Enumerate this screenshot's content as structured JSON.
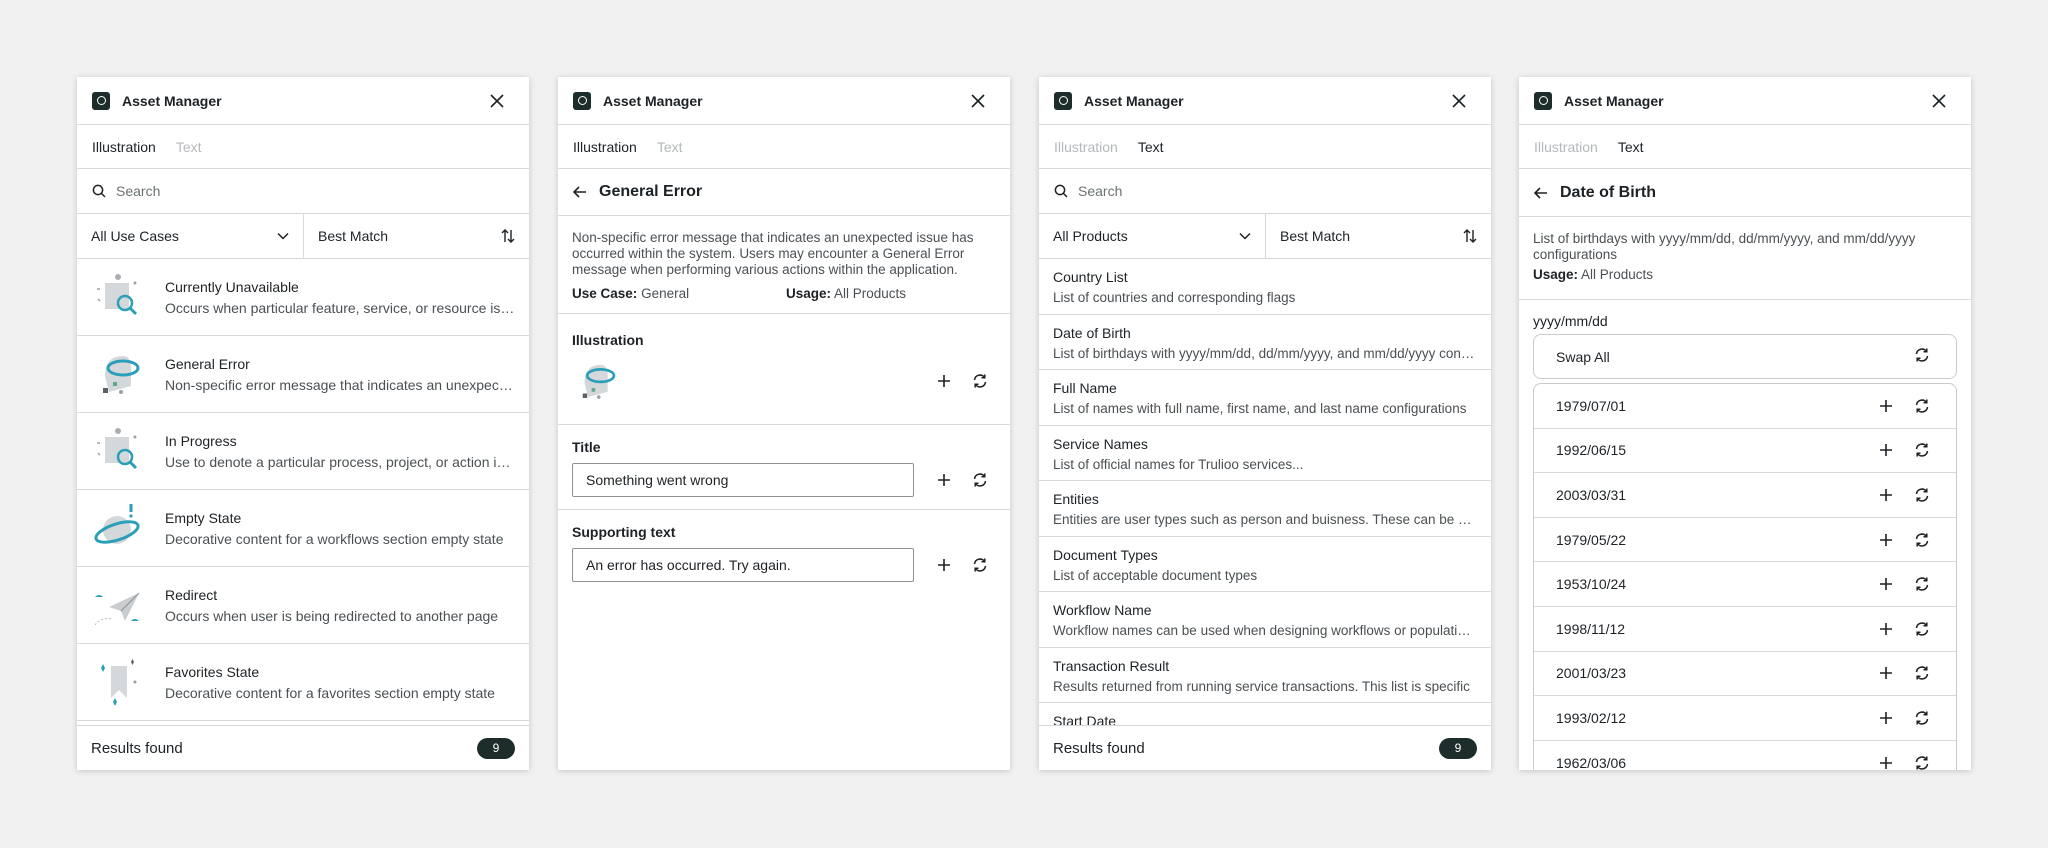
{
  "panels": {
    "p1": {
      "app_title": "Asset Manager",
      "tabs": [
        "Illustration",
        "Text"
      ],
      "active_tab": 0,
      "search_placeholder": "Search",
      "filter": "All Use Cases",
      "sort": "Best Match",
      "items": [
        {
          "title": "Currently Unavailable",
          "desc": "Occurs when particular feature, service, or resource is not available",
          "icon": "magnifier-illustration"
        },
        {
          "title": "General Error",
          "desc": "Non-specific error message that indicates an unexpected issue has occurred",
          "icon": "planet-error-illustration"
        },
        {
          "title": "In Progress",
          "desc": "Use to denote a particular process, project, or action is in progress",
          "icon": "magnifier-illustration"
        },
        {
          "title": "Empty State",
          "desc": "Decorative content for a workflows section empty state",
          "icon": "planet-illustration"
        },
        {
          "title": "Redirect",
          "desc": "Occurs when user is being redirected to another page",
          "icon": "paper-plane-illustration"
        },
        {
          "title": "Favorites State",
          "desc": "Decorative content for a favorites section empty state",
          "icon": "bookmark-illustration"
        }
      ],
      "results_label": "Results found",
      "results_count": "9"
    },
    "p2": {
      "app_title": "Asset Manager",
      "tabs": [
        "Illustration",
        "Text"
      ],
      "active_tab": 0,
      "back_title": "General Error",
      "description": "Non-specific error message that indicates an unexpected issue has occurred within the system. Users may encounter a General Error message when performing various actions within the application.",
      "use_case_label": "Use Case:",
      "use_case_value": "General",
      "usage_label": "Usage:",
      "usage_value": "All Products",
      "illustration_label": "Illustration",
      "title_label": "Title",
      "title_value": "Something went wrong",
      "supporting_label": "Supporting text",
      "supporting_value": "An error has occurred. Try again."
    },
    "p3": {
      "app_title": "Asset Manager",
      "tabs": [
        "Illustration",
        "Text"
      ],
      "active_tab": 1,
      "search_placeholder": "Search",
      "filter": "All Products",
      "sort": "Best Match",
      "items": [
        {
          "title": "Country List",
          "desc": "List of countries and corresponding flags"
        },
        {
          "title": "Date of Birth",
          "desc": "List of birthdays with yyyy/mm/dd, dd/mm/yyyy, and mm/dd/yyyy configurations"
        },
        {
          "title": "Full Name",
          "desc": "List of names with full name, first name, and last name configurations"
        },
        {
          "title": "Service Names",
          "desc": "List of official names for Trulioo services..."
        },
        {
          "title": "Entities",
          "desc": "Entities are user types such as person and buisness. These can be used"
        },
        {
          "title": "Document Types",
          "desc": "List of acceptable document types"
        },
        {
          "title": "Workflow Name",
          "desc": "Workflow names can be used when designing workflows or populating lists"
        },
        {
          "title": "Transaction Result",
          "desc": "Results returned from running service transactions. This list is specific"
        },
        {
          "title": "Start Date",
          "desc": ""
        }
      ],
      "results_label": "Results found",
      "results_count": "9"
    },
    "p4": {
      "app_title": "Asset Manager",
      "tabs": [
        "Illustration",
        "Text"
      ],
      "active_tab": 1,
      "back_title": "Date of Birth",
      "description": "List of birthdays with yyyy/mm/dd, dd/mm/yyyy, and mm/dd/yyyy configurations",
      "usage_label": "Usage:",
      "usage_value": "All Products",
      "format_label": "yyyy/mm/dd",
      "swap_all": "Swap All",
      "dates": [
        "1979/07/01",
        "1992/06/15",
        "2003/03/31",
        "1979/05/22",
        "1953/10/24",
        "1998/11/12",
        "2001/03/23",
        "1993/02/12",
        "1962/03/06"
      ]
    }
  },
  "colors": {
    "logo": "#1d2d2b",
    "accent_teal": "#2a9fb8",
    "badge": "#1d2d2b",
    "border": "#d6d8da"
  }
}
